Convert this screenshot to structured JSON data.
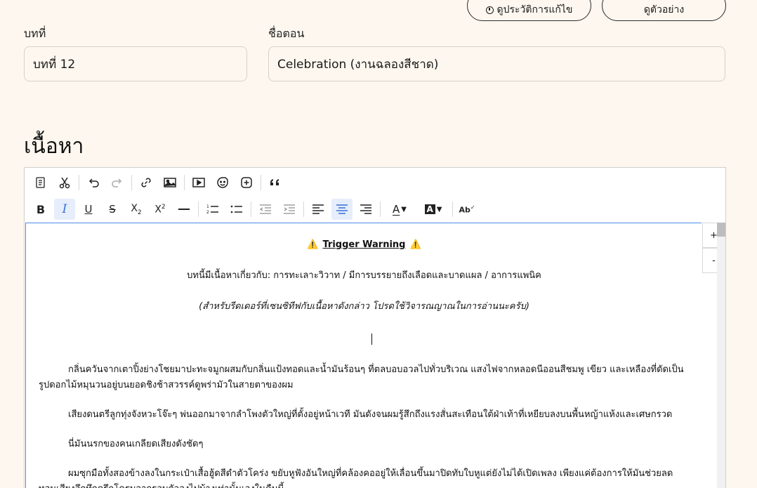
{
  "header": {
    "history_button": "ดูประวัติการแก้ไข",
    "preview_button": "ดูตัวอย่าง"
  },
  "form": {
    "chapter_label": "บทที่",
    "chapter_value": "บทที่ 12",
    "title_label": "ชื่อตอน",
    "title_value": "Celebration (งานฉลองสีชาด)"
  },
  "content_section": {
    "heading": "เนื้อหา"
  },
  "toolbar": {
    "row1": [
      "paste-icon",
      "cut-icon",
      "undo-icon",
      "redo-icon",
      "link-icon",
      "image-icon",
      "video-icon",
      "sticker-icon",
      "plus-circle-icon",
      "quote-icon"
    ],
    "row2": [
      "bold-icon",
      "italic-icon",
      "underline-icon",
      "strikethrough-icon",
      "subscript-icon",
      "superscript-icon",
      "horizontal-rule-icon",
      "ordered-list-icon",
      "bullet-list-icon",
      "outdent-icon",
      "indent-icon",
      "align-left-icon",
      "align-center-icon",
      "align-right-icon",
      "font-color-icon",
      "highlight-color-icon",
      "spellcheck-icon"
    ],
    "active": [
      "italic-icon",
      "align-center-icon"
    ],
    "accent_color": "#4a8be8"
  },
  "editor": {
    "warning_emoji": "⚠️",
    "warning_title": "Trigger Warning",
    "description": "บทนี้มีเนื้อหาเกี่ยวกับ: การทะเลาะวิวาท / มีการบรรยายถึงเลือดและบาดแผล / อาการแพนิค",
    "note": "(สำหรับรีดเดอร์ที่เซนซิทีฟกับเนื้อหาดังกล่าว โปรดใช้วิจารณญาณในการอ่านนะครับ)",
    "paragraphs": [
      "กลิ่นควันจากเตาปิ้งย่างโชยมาปะทะจมูกผสมกับกลิ่นแป้งทอดและน้ำมันร้อนๆ ที่ตลบอบอวลไปทั่วบริเวณ แสงไฟจากหลอดนีออนสีชมพู เขียว และเหลืองที่ดัดเป็นรูปดอกไม้หมุนวนอยู่บนยอดชิงช้าสวรรค์ดูพร่ามัวในสายตาของผม",
      "เสียงดนตรีลูกทุ่งจังหวะโจ๊ะๆ พ่นออกมาจากลำโพงตัวใหญ่ที่ตั้งอยู่หน้าเวที มันดังจนผมรู้สึกถึงแรงสั่นสะเทือนใต้ฝ่าเท้าที่เหยียบลงบนพื้นหญ้าแห้งและเศษกรวด",
      "นี่มันนรกของคนเกลียดเสียงดังชัดๆ",
      "ผมซุกมือทั้งสองข้างลงในกระเป๋าเสื้อฮู้ดสีดำตัวโคร่ง ขยับหูฟังอันใหญ่ที่คล้องคออยู่ให้เลื่อนขึ้นมาปิดทับใบหูแต่ยังไม่ได้เปิดเพลง เพียงแค่ต้องการให้มันช่วยลดทอนเสียงอึกทึกครึกโครมจากรอบตัวลงไปบ้างเท่านั้นเองในคืนนี้"
    ]
  },
  "zoom": {
    "in_label": "+",
    "out_label": "-"
  }
}
